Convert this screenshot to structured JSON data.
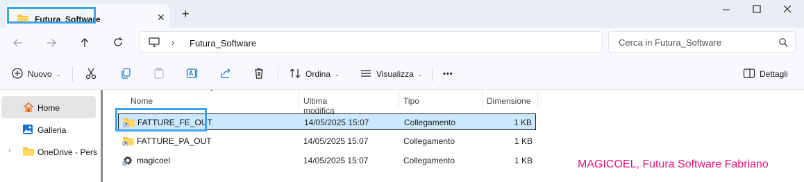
{
  "tab": {
    "title": "Futura_Software",
    "close_glyph": "✕",
    "new_glyph": "+"
  },
  "window": {
    "minimize": "minimize",
    "maximize": "maximize",
    "close": "close"
  },
  "address": {
    "chevron": "›",
    "path": "Futura_Software"
  },
  "search": {
    "placeholder": "Cerca in Futura_Software"
  },
  "commands": {
    "new": "Nuovo",
    "sort": "Ordina",
    "view": "Visualizza",
    "more": "•••",
    "details": "Dettagli"
  },
  "nav": {
    "items": [
      {
        "label": "Home"
      },
      {
        "label": "Galleria"
      },
      {
        "label": "OneDrive - Personal"
      }
    ]
  },
  "columns": {
    "name": "Nome",
    "modified": "Ultima modifica",
    "type": "Tipo",
    "size": "Dimensione"
  },
  "files": [
    {
      "name": "FATTURE_FE_OUT",
      "modified": "14/05/2025 15:07",
      "type": "Collegamento",
      "size": "1 KB"
    },
    {
      "name": "FATTURE_PA_OUT",
      "modified": "14/05/2025 15:07",
      "type": "Collegamento",
      "size": "1 KB"
    },
    {
      "name": "magicoel",
      "modified": "14/05/2025 15:07",
      "type": "Collegamento",
      "size": "1 KB"
    }
  ],
  "watermark": "MAGICOEL, Futura Software Fabriano",
  "colors": {
    "accent": "#3aa3f2",
    "selection": "#cce8ff",
    "folder": "#f8c53a",
    "watermark": "#e0157a"
  }
}
